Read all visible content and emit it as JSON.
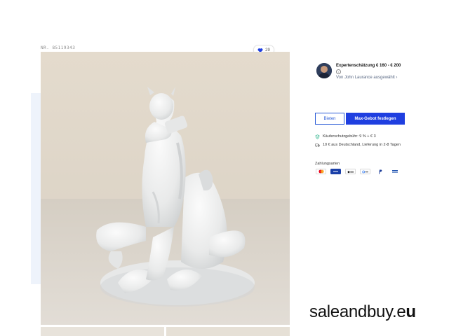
{
  "lot": {
    "number": "NR. 85119343"
  },
  "favorites": {
    "count": "29"
  },
  "expert": {
    "estimate": "Expertenschätzung € 160 - € 200",
    "by": "Von John Laurance ausgewählt ›"
  },
  "actions": {
    "bid_label": "Bieten",
    "max_bid_label": "Max-Gebot festlegen"
  },
  "features": {
    "buyer_protection": "Käuferschutzgebühr: 9 % + € 3",
    "shipping": "10 € aus Deutschland, Lieferung in 2-8 Tagen"
  },
  "payment": {
    "title": "Zahlungsarten",
    "methods": [
      "Mastercard",
      "Visa",
      "Apple Pay",
      "G Pay",
      "PayPal",
      "Bank"
    ]
  },
  "watermark": {
    "text": "saleandbuy.e",
    "suffix": "u"
  }
}
